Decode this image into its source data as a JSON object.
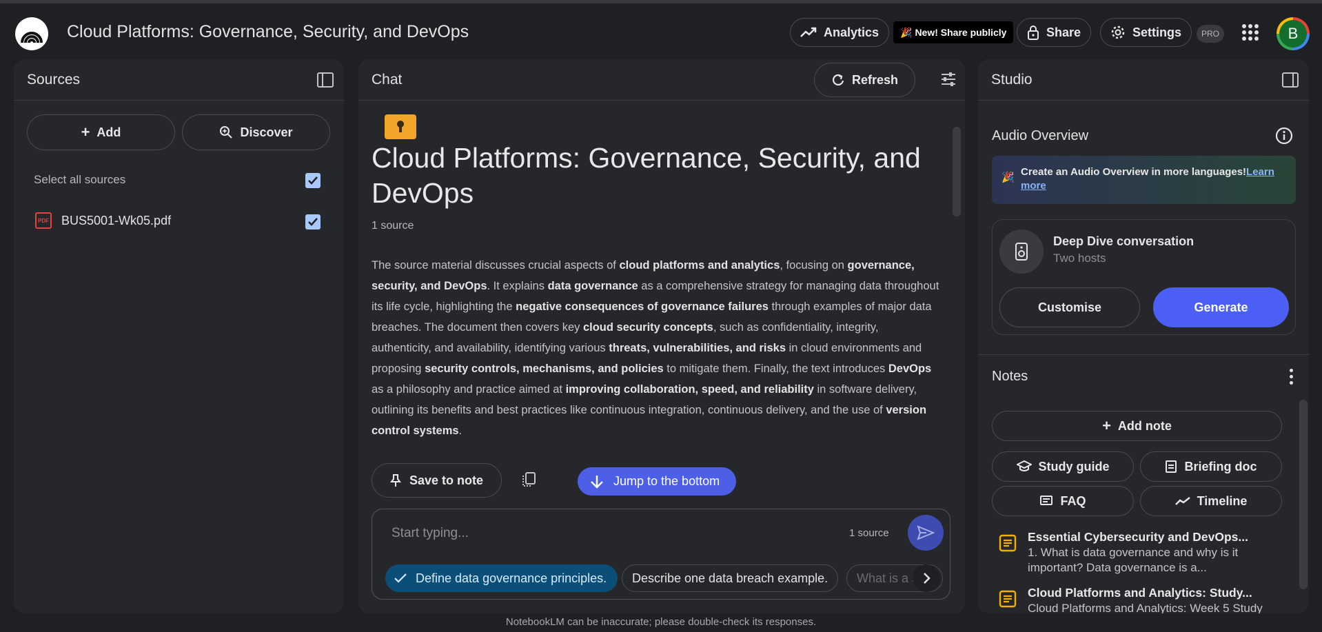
{
  "header": {
    "title": "Cloud Platforms: Governance, Security, and DevOps",
    "analytics": "Analytics",
    "new_share": "New! Share publicly",
    "share": "Share",
    "settings": "Settings",
    "pro": "PRO",
    "avatar_initial": "B"
  },
  "sources": {
    "title": "Sources",
    "add": "Add",
    "discover": "Discover",
    "select_all": "Select all sources",
    "items": [
      {
        "name": "BUS5001-Wk05.pdf",
        "type": "PDF",
        "checked": true
      }
    ]
  },
  "chat": {
    "title": "Chat",
    "refresh": "Refresh",
    "notebook_title": "Cloud Platforms: Governance, Security, and DevOps",
    "source_count": "1 source",
    "summary": [
      {
        "t": "The source material discusses crucial aspects of ",
        "b": false
      },
      {
        "t": "cloud platforms and analytics",
        "b": true
      },
      {
        "t": ", focusing on ",
        "b": false
      },
      {
        "t": "governance, security, and DevOps",
        "b": true
      },
      {
        "t": ". It explains ",
        "b": false
      },
      {
        "t": "data governance",
        "b": true
      },
      {
        "t": " as a comprehensive strategy for managing data throughout its life cycle, highlighting the ",
        "b": false
      },
      {
        "t": "negative consequences of governance failures",
        "b": true
      },
      {
        "t": " through examples of major data breaches. The document then covers key ",
        "b": false
      },
      {
        "t": "cloud security concepts",
        "b": true
      },
      {
        "t": ", such as confidentiality, integrity, authenticity, and availability, identifying various ",
        "b": false
      },
      {
        "t": "threats, vulnerabilities, and risks",
        "b": true
      },
      {
        "t": " in cloud environments and proposing ",
        "b": false
      },
      {
        "t": "security controls, mechanisms, and policies",
        "b": true
      },
      {
        "t": " to mitigate them. Finally, the text introduces ",
        "b": false
      },
      {
        "t": "DevOps",
        "b": true
      },
      {
        "t": " as a philosophy and practice aimed at ",
        "b": false
      },
      {
        "t": "improving collaboration, speed, and reliability",
        "b": true
      },
      {
        "t": " in software delivery, outlining its benefits and best practices like continuous integration, continuous delivery, and the use of ",
        "b": false
      },
      {
        "t": "version control systems",
        "b": true
      },
      {
        "t": ".",
        "b": false
      }
    ],
    "save_to_note": "Save to note",
    "jump_to_bottom": "Jump to the bottom",
    "input_placeholder": "Start typing...",
    "input_source_count": "1 source",
    "suggestions": [
      "Define data governance principles.",
      "Describe one data breach example.",
      "What is a s"
    ]
  },
  "studio": {
    "title": "Studio",
    "audio_overview": "Audio Overview",
    "banner_text": "Create an Audio Overview in more languages!",
    "banner_link": "Learn more",
    "deep_dive_title": "Deep Dive conversation",
    "deep_dive_sub": "Two hosts",
    "customise": "Customise",
    "generate": "Generate",
    "notes_title": "Notes",
    "add_note": "Add note",
    "study_guide": "Study guide",
    "briefing_doc": "Briefing doc",
    "faq": "FAQ",
    "timeline": "Timeline",
    "notes": [
      {
        "title": "Essential Cybersecurity and DevOps...",
        "preview": "1. What is data governance and why is it important? Data governance is a..."
      },
      {
        "title": "Cloud Platforms and Analytics: Study...",
        "preview": "Cloud Platforms and Analytics: Week 5 Study"
      }
    ]
  },
  "footer": "NotebookLM can be inaccurate; please double-check its responses.",
  "colors": {
    "accent": "#4c5ff5",
    "background": "#1f2023",
    "panel": "#26272b",
    "chip_selected": "#0b4f78",
    "note_icon": "#f6b100"
  }
}
